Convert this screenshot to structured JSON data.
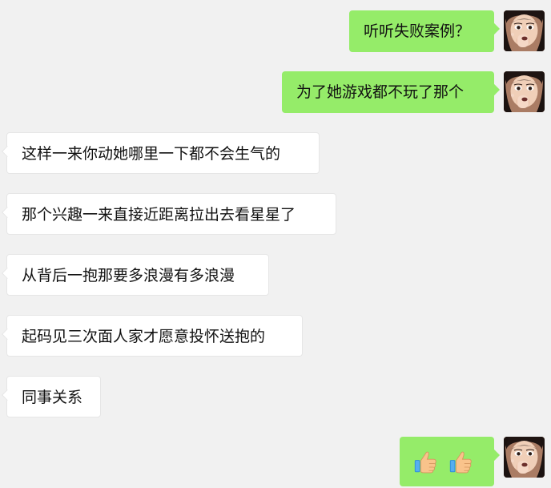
{
  "chat": {
    "messages": [
      {
        "side": "right",
        "text": "听听失败案例？"
      },
      {
        "side": "right",
        "text": "为了她游戏都不玩了那个"
      },
      {
        "side": "left",
        "text": "这样一来你动她哪里一下都不会生气的"
      },
      {
        "side": "left",
        "text": "那个兴趣一来直接近距离拉出去看星星了"
      },
      {
        "side": "left",
        "text": "从背后一抱那要多浪漫有多浪漫"
      },
      {
        "side": "left",
        "text": "起码见三次面人家才愿意投怀送抱的"
      },
      {
        "side": "left",
        "text": "同事关系"
      },
      {
        "side": "right",
        "emoji": [
          "thumbs-up-icon",
          "thumbs-up-icon"
        ]
      }
    ]
  },
  "colors": {
    "background": "#f1f1f1",
    "sent_bubble": "#95ec69",
    "received_bubble": "#ffffff"
  }
}
